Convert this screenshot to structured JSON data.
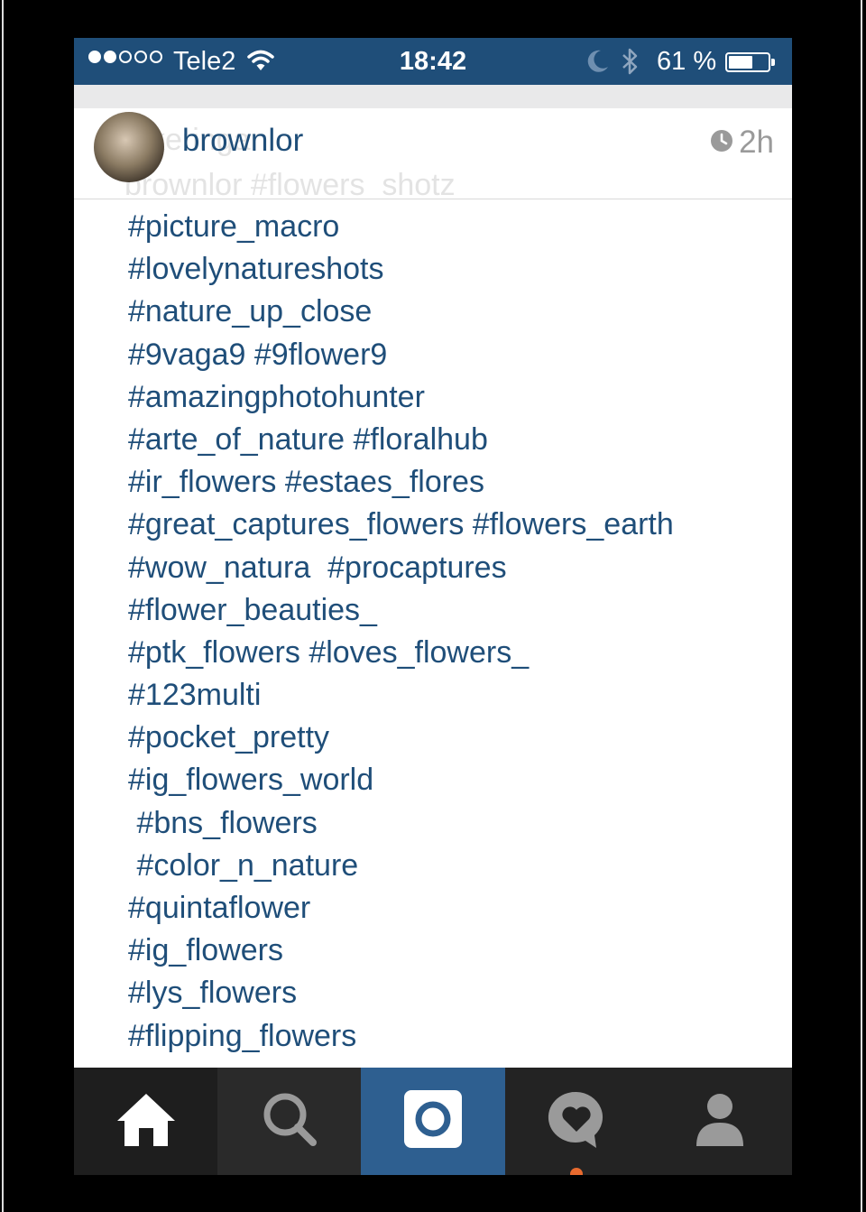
{
  "status_bar": {
    "carrier": "Tele2",
    "time": "18:42",
    "battery_percent": "61 %",
    "signal_bars": 2,
    "signal_total": 5,
    "battery_level": 0.61
  },
  "post": {
    "username": "brownlor",
    "time_ago": "2h",
    "ghost_text_1": "keringar",
    "ghost_text_2": "brownlor #flowers_shotz"
  },
  "caption": {
    "lines": [
      "#picture_macro",
      "#lovelynatureshots",
      "#nature_up_close",
      "#9vaga9 #9flower9",
      "#amazingphotohunter",
      "#arte_of_nature #floralhub",
      "#ir_flowers #estaes_flores",
      "#great_captures_flowers #flowers_earth",
      "#wow_natura  #procaptures",
      "#flower_beauties_",
      "#ptk_flowers #loves_flowers_",
      "#123multi",
      "#pocket_pretty",
      "#ig_flowers_world",
      " #bns_flowers",
      " #color_n_nature",
      "#quintaflower",
      "#ig_flowers",
      "#lys_flowers",
      "#flipping_flowers"
    ]
  },
  "tabbar": {
    "tabs": [
      {
        "icon": "home-icon"
      },
      {
        "icon": "search-icon"
      },
      {
        "icon": "camera-icon"
      },
      {
        "icon": "activity-heart-icon"
      },
      {
        "icon": "profile-icon"
      }
    ]
  },
  "colors": {
    "accent_blue": "#1f4e79",
    "camera_tab": "#2e5f90",
    "tabbar": "#232323",
    "notification": "#e86a2e"
  }
}
